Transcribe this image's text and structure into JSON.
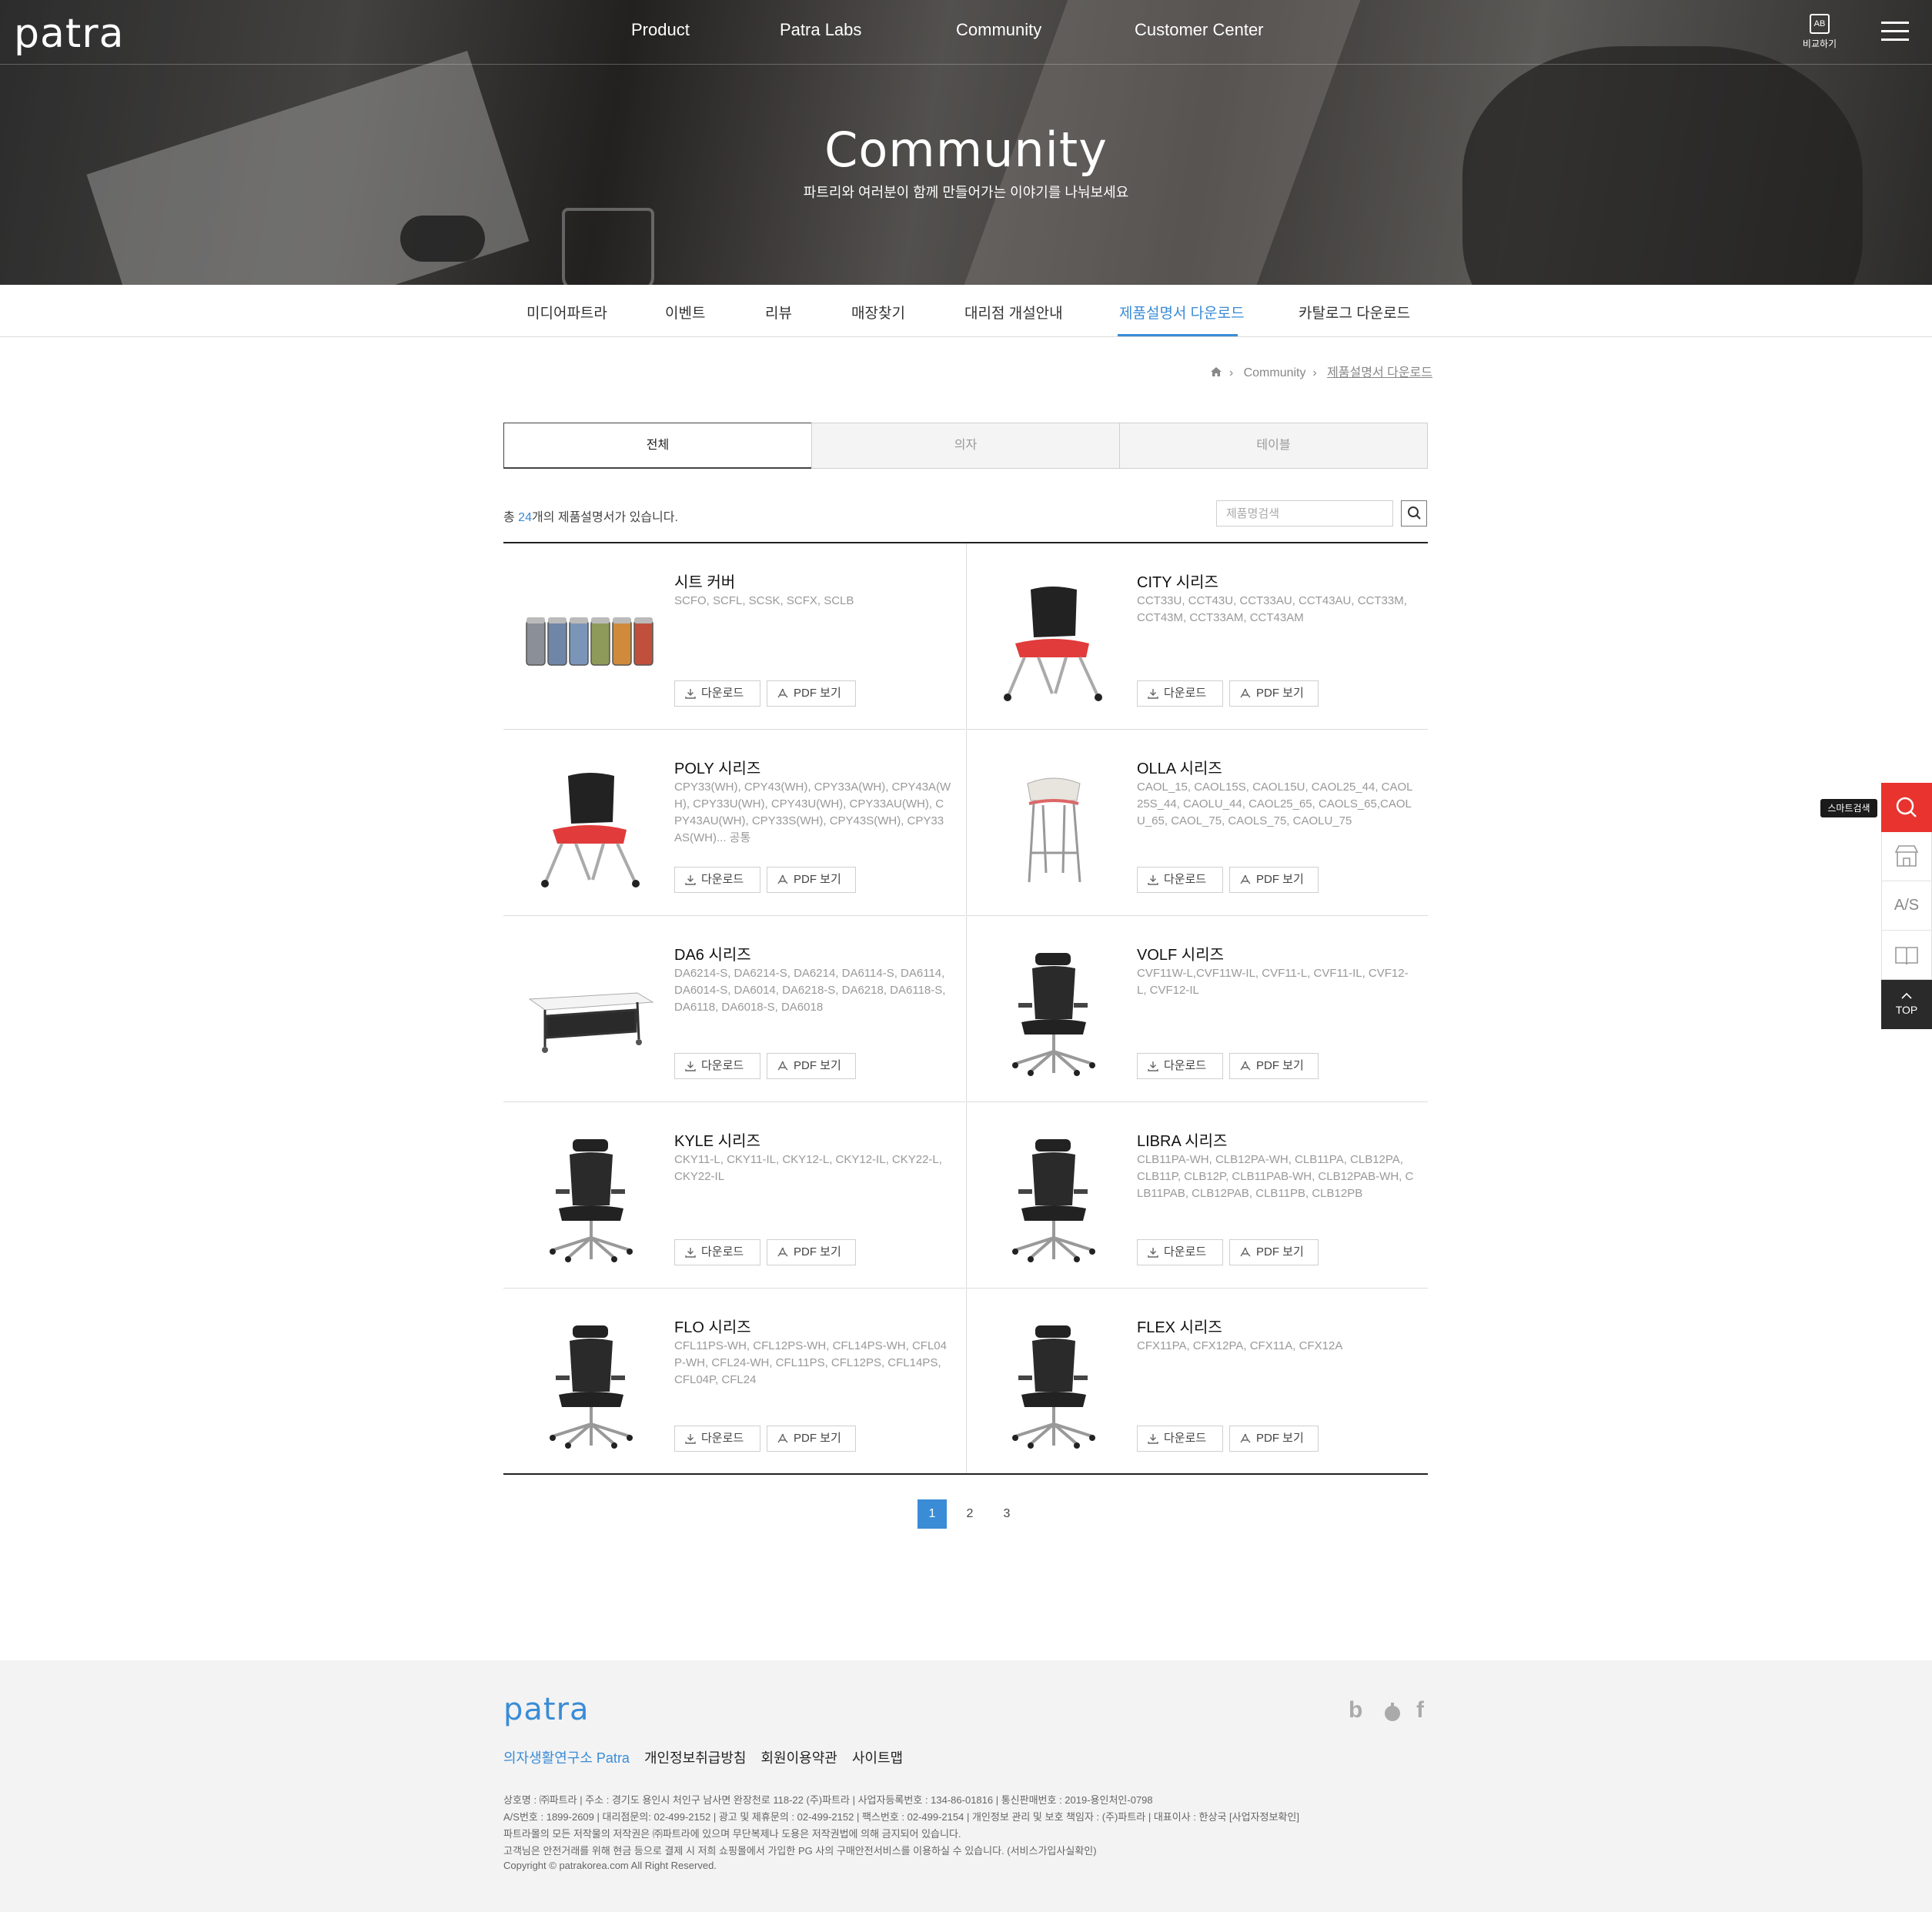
{
  "header": {
    "logo": "patra",
    "nav": [
      "Product",
      "Patra Labs",
      "Community",
      "Customer Center"
    ],
    "compare_label": "비교하기",
    "compare_icon": "AB"
  },
  "hero": {
    "title": "Community",
    "subtitle": "파트리와 여러분이 함께 만들어가는 이야기를 나눠보세요"
  },
  "subnav": {
    "items": [
      "미디어파트라",
      "이벤트",
      "리뷰",
      "매장찾기",
      "대리점 개설안내",
      "제품설명서 다운로드",
      "카탈로그 다운로드"
    ],
    "active": "제품설명서 다운로드"
  },
  "breadcrumb": {
    "section": "Community",
    "current": "제품설명서 다운로드"
  },
  "filter_tabs": [
    "전체",
    "의자",
    "테이블"
  ],
  "results": {
    "prefix": "총 ",
    "count": "24",
    "suffix": "개의 제품설명서가 있습니다."
  },
  "search": {
    "placeholder": "제품명검색"
  },
  "buttons": {
    "download": "다운로드",
    "pdf": "PDF 보기"
  },
  "products": [
    {
      "name": "시트 커버",
      "models": "SCFO, SCFL, SCSK, SCFX, SCLB",
      "icon": "seat-cover-image"
    },
    {
      "name": "CITY 시리즈",
      "models": "CCT33U, CCT43U, CCT33AU, CCT43AU, CCT33M, CCT43M, CCT33AM, CCT43AM",
      "icon": "chair-image"
    },
    {
      "name": "POLY 시리즈",
      "models": "CPY33(WH), CPY43(WH), CPY33A(WH), CPY43A(WH), CPY33U(WH), CPY43U(WH), CPY33AU(WH), CPY43AU(WH), CPY33S(WH), CPY43S(WH), CPY33AS(WH)... 공통",
      "icon": "chair-image"
    },
    {
      "name": "OLLA 시리즈",
      "models": "CAOL_15, CAOL15S, CAOL15U, CAOL25_44, CAOL25S_44, CAOLU_44, CAOL25_65, CAOLS_65,CAOLU_65, CAOL_75, CAOLS_75, CAOLU_75",
      "icon": "stool-image"
    },
    {
      "name": "DA6 시리즈",
      "models": "DA6214-S, DA6214-S, DA6214, DA6114-S, DA6114, DA6014-S, DA6014, DA6218-S, DA6218, DA6118-S, DA6118, DA6018-S, DA6018",
      "icon": "table-image"
    },
    {
      "name": "VOLF 시리즈",
      "models": "CVF11W-L,CVF11W-IL, CVF11-L, CVF11-IL, CVF12-L, CVF12-IL",
      "icon": "office-chair-image"
    },
    {
      "name": "KYLE 시리즈",
      "models": "CKY11-L, CKY11-IL, CKY12-L, CKY12-IL, CKY22-L, CKY22-IL",
      "icon": "office-chair-image"
    },
    {
      "name": "LIBRA 시리즈",
      "models": "CLB11PA-WH, CLB12PA-WH, CLB11PA, CLB12PA, CLB11P, CLB12P, CLB11PAB-WH, CLB12PAB-WH, CLB11PAB, CLB12PAB, CLB11PB, CLB12PB",
      "icon": "office-chair-image"
    },
    {
      "name": "FLO 시리즈",
      "models": "CFL11PS-WH, CFL12PS-WH, CFL14PS-WH, CFL04P-WH, CFL24-WH, CFL11PS, CFL12PS, CFL14PS, CFL04P, CFL24",
      "icon": "office-chair-image"
    },
    {
      "name": "FLEX 시리즈",
      "models": "CFX11PA, CFX12PA, CFX11A, CFX12A",
      "icon": "office-chair-image"
    }
  ],
  "pagination": {
    "pages": [
      "1",
      "2",
      "3"
    ],
    "current": "1"
  },
  "quick_menu": {
    "tooltip": "스마트검색",
    "as_label": "A/S",
    "top_label": "TOP"
  },
  "footer": {
    "logo": "patra",
    "links": [
      "의자생활연구소 Patra",
      "개인정보취급방침",
      "회원이용약관",
      "사이트맵"
    ],
    "info": [
      "상호명 : ㈜파트라   |   주소 : 경기도 용인시 처인구 남사면 완장천로 118-22 (주)파트라   |   사업자등록번호 : 134-86-01816   |   통신판매번호 : 2019-용인처인-0798",
      "A/S번호 : 1899-2609   |   대리점문의: 02-499-2152   |   광고 및 제휴문의 : 02-499-2152   |   팩스번호 : 02-499-2154   |   개인정보 관리 및 보호 책임자 : (주)파트라   |   대표이사 : 한상국 [사업자정보확인]",
      "파트라몰의 모든 저작물의 저작권은 ㈜파트라에 있으며 무단복제나 도용은 저작권법에 의해 금지되어 있습니다.",
      "고객님은 안전거래를 위해 현금 등으로 결제 시 저희 쇼핑몰에서 가입한 PG 사의 구매안전서비스를 이용하실 수 있습니다. (서비스가입사실확인)",
      "Copyright © patrakorea.com All Right Reserved."
    ],
    "social": [
      "b",
      "f"
    ]
  },
  "colors": {
    "accent": "#3a8cd6",
    "quick_red": "#e8332e",
    "top_dark": "#2a2a2a"
  }
}
